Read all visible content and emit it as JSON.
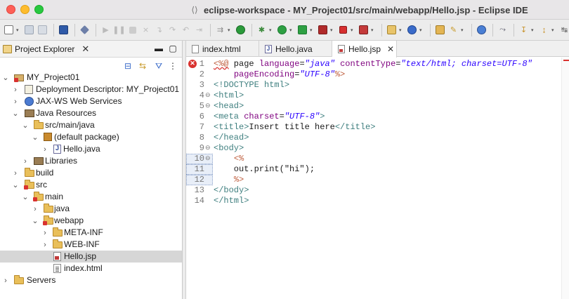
{
  "window": {
    "title": "eclipse-workspace - MY_Project01/src/main/webapp/Hello.jsp - Eclipse IDE"
  },
  "toolbar": {
    "buttons": [
      "new-icon",
      "save-icon",
      "save-all-icon",
      "terminal-icon",
      "skip-breakpoints-icon",
      "resume-icon",
      "suspend-icon",
      "terminate-icon",
      "disconnect-icon",
      "step-into-icon",
      "step-over-icon",
      "step-return-icon",
      "drop-to-frame-icon",
      "use-step-filters-icon",
      "spring-boot-icon",
      "debug-icon",
      "run-icon",
      "coverage-icon",
      "run-external-icon",
      "stop-icon",
      "server-icon",
      "new-package-icon",
      "new-class-icon",
      "open-type-icon",
      "search-icon",
      "globe-icon",
      "next-annotation-icon",
      "back-icon",
      "forward-icon"
    ]
  },
  "explorer": {
    "title": "Project Explorer",
    "close": "✕",
    "items": [
      {
        "label": "MY_Project01"
      },
      {
        "label": "Deployment Descriptor: MY_Project01"
      },
      {
        "label": "JAX-WS Web Services"
      },
      {
        "label": "Java Resources"
      },
      {
        "label": "src/main/java"
      },
      {
        "label": "(default package)"
      },
      {
        "label": "Hello.java"
      },
      {
        "label": "Libraries"
      },
      {
        "label": "build"
      },
      {
        "label": "src"
      },
      {
        "label": "main"
      },
      {
        "label": "java"
      },
      {
        "label": "webapp"
      },
      {
        "label": "META-INF"
      },
      {
        "label": "WEB-INF"
      },
      {
        "label": "Hello.jsp"
      },
      {
        "label": "index.html"
      },
      {
        "label": "Servers"
      }
    ]
  },
  "editor": {
    "tabs": [
      {
        "label": "index.html"
      },
      {
        "label": "Hello.java"
      },
      {
        "label": "Hello.jsp",
        "close": "✕"
      }
    ],
    "lines": [
      {
        "n": "1",
        "parts": [
          [
            "jspd",
            "<%@"
          ],
          [
            "plain",
            " page "
          ],
          [
            "attr",
            "language"
          ],
          [
            "plain",
            "="
          ],
          [
            "str",
            "\"java\""
          ],
          [
            "plain",
            " "
          ],
          [
            "attr",
            "contentType"
          ],
          [
            "plain",
            "="
          ],
          [
            "str",
            "\"text/html; charset=UTF-8\""
          ]
        ]
      },
      {
        "n": "2",
        "parts": [
          [
            "plain",
            "    "
          ],
          [
            "attr",
            "pageEncoding"
          ],
          [
            "plain",
            "="
          ],
          [
            "str",
            "\"UTF-8\""
          ],
          [
            "jspd",
            "%>"
          ]
        ]
      },
      {
        "n": "3",
        "parts": [
          [
            "tag",
            "<!DOCTYPE html>"
          ]
        ]
      },
      {
        "n": "4",
        "parts": [
          [
            "tag",
            "<html>"
          ]
        ]
      },
      {
        "n": "5",
        "parts": [
          [
            "tag",
            "<head>"
          ]
        ]
      },
      {
        "n": "6",
        "parts": [
          [
            "tag",
            "<meta "
          ],
          [
            "attr",
            "charset"
          ],
          [
            "plain",
            "="
          ],
          [
            "str",
            "\"UTF-8\""
          ],
          [
            "tag",
            ">"
          ]
        ]
      },
      {
        "n": "7",
        "parts": [
          [
            "tag",
            "<title>"
          ],
          [
            "plain",
            "Insert title here"
          ],
          [
            "tag",
            "</title>"
          ]
        ]
      },
      {
        "n": "8",
        "parts": [
          [
            "tag",
            "</head>"
          ]
        ]
      },
      {
        "n": "9",
        "parts": [
          [
            "tag",
            "<body>"
          ]
        ]
      },
      {
        "n": "10",
        "parts": [
          [
            "plain",
            "    "
          ],
          [
            "jspd",
            "<%"
          ]
        ]
      },
      {
        "n": "11",
        "parts": [
          [
            "plain",
            "    out.print(\"hi\");"
          ]
        ]
      },
      {
        "n": "12",
        "parts": [
          [
            "plain",
            "    "
          ],
          [
            "jspd",
            "%>"
          ]
        ]
      },
      {
        "n": "13",
        "parts": [
          [
            "tag",
            "</body>"
          ]
        ]
      },
      {
        "n": "14",
        "parts": [
          [
            "tag",
            "</html>"
          ]
        ]
      }
    ]
  },
  "colors": {
    "error": "#d9322f",
    "tag": "#3f7f7f",
    "attribute": "#7f007f",
    "string": "#2a00ff",
    "jsp_delimiter": "#bf5f3f",
    "selection": "#d6d6d6"
  }
}
